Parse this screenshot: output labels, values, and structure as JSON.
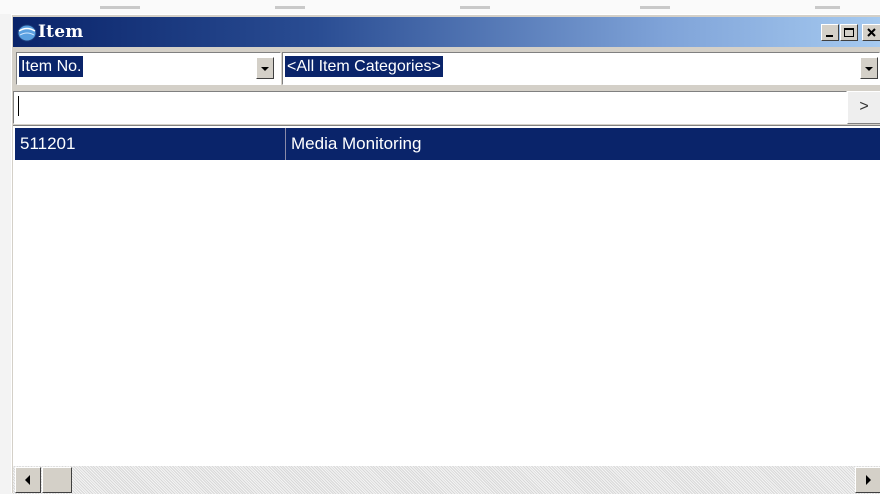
{
  "window": {
    "title": "Item",
    "app_icon": "globe-icon",
    "controls": [
      "minimize-icon",
      "maximize-icon",
      "close-icon"
    ]
  },
  "filters": {
    "sort_field": "Item No.",
    "category": "<All Item Categories>"
  },
  "search": {
    "value": "",
    "go_label": ">"
  },
  "list": {
    "rows": [
      {
        "item_no": "511201",
        "description": "Media Monitoring"
      }
    ]
  },
  "colors": {
    "titlebar_start": "#0a246a",
    "titlebar_end": "#a6caf0",
    "selection": "#0a246a",
    "face": "#d4d0c8"
  }
}
